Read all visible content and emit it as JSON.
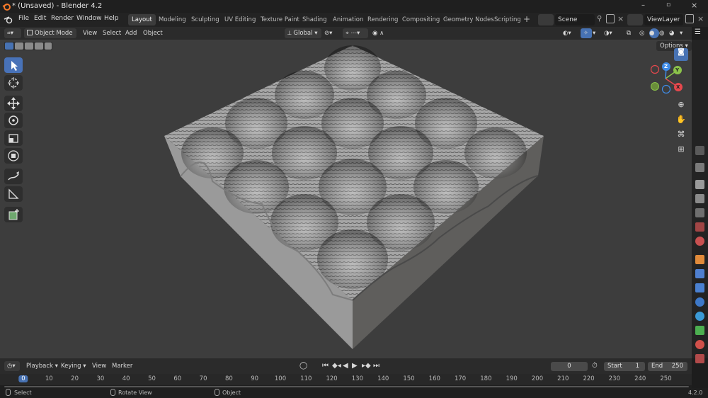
{
  "app": {
    "title": "* (Unsaved) - Blender 4.2",
    "version": "4.2.0"
  },
  "menu": [
    "File",
    "Edit",
    "Render",
    "Window",
    "Help"
  ],
  "workspaces": [
    "Layout",
    "Modeling",
    "Sculpting",
    "UV Editing",
    "Texture Paint",
    "Shading",
    "Animation",
    "Rendering",
    "Compositing",
    "Geometry Nodes",
    "Scripting"
  ],
  "active_workspace": "Layout",
  "scene": {
    "name": "Scene"
  },
  "view_layer": {
    "name": "ViewLayer"
  },
  "viewport_header": {
    "mode": "Object Mode",
    "menus": [
      "View",
      "Select",
      "Add",
      "Object"
    ],
    "orientation": "Global",
    "options_label": "Options"
  },
  "gizmo": {
    "x": "X",
    "y": "Y",
    "z": "Z"
  },
  "timeline": {
    "menus": [
      "Playback",
      "Keying",
      "View",
      "Marker"
    ],
    "current_frame": "0",
    "start_label": "Start",
    "start_value": "1",
    "end_label": "End",
    "end_value": "250",
    "ruler": [
      "0",
      "10",
      "20",
      "30",
      "40",
      "50",
      "60",
      "70",
      "80",
      "90",
      "100",
      "110",
      "120",
      "130",
      "140",
      "150",
      "160",
      "170",
      "180",
      "190",
      "200",
      "210",
      "220",
      "230",
      "240",
      "250"
    ]
  },
  "status": {
    "select": "Select",
    "rotate": "Rotate View",
    "object": "Object"
  },
  "colors": {
    "accent": "#4772b3",
    "x_axis": "#e5484d",
    "y_axis": "#8bc34a",
    "z_axis": "#3f8ce8"
  }
}
